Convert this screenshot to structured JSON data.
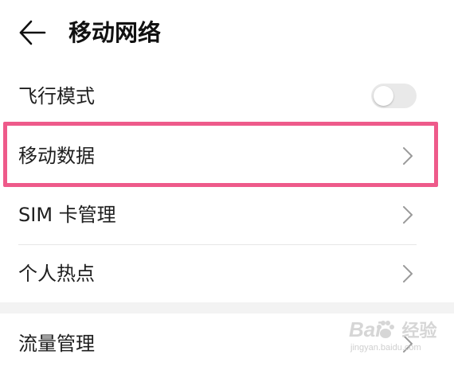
{
  "header": {
    "back_icon": "arrow-left-icon",
    "title": "移动网络"
  },
  "settings": [
    {
      "label": "飞行模式",
      "control": "toggle",
      "toggle_on": false
    },
    {
      "label": "移动数据",
      "control": "chevron",
      "highlighted": true
    },
    {
      "label": "SIM 卡管理",
      "control": "chevron"
    },
    {
      "label": "个人热点",
      "control": "chevron"
    },
    {
      "label": "流量管理",
      "control": "chevron"
    }
  ],
  "watermark": {
    "brand": "Bai",
    "brand_suffix": "经验",
    "url": "jingyan.baidu.com"
  },
  "colors": {
    "highlight_border": "#ee5a8a",
    "toggle_off": "#e9e9e9",
    "section_gap": "#f3f3f3"
  }
}
